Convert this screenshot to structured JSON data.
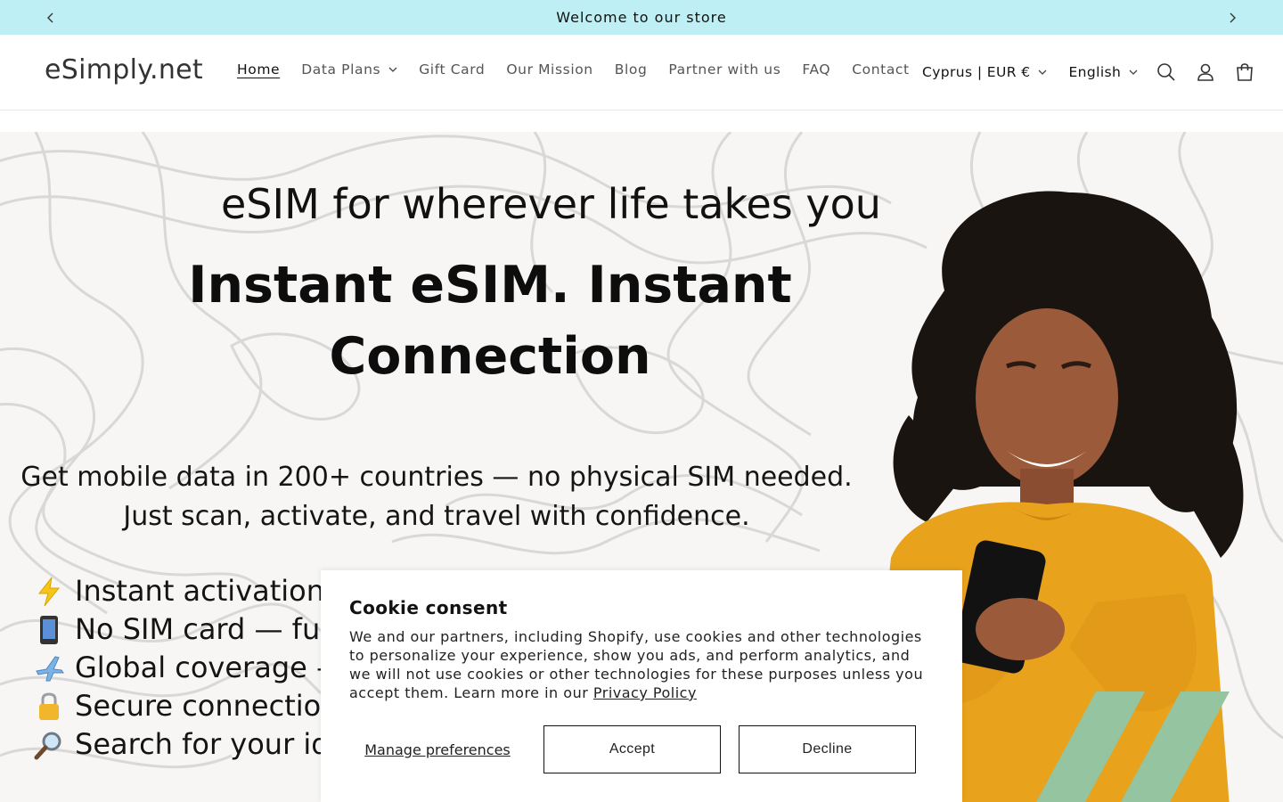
{
  "announcement": {
    "message": "Welcome to our store",
    "prev_icon": "chevron-left-icon",
    "next_icon": "chevron-right-icon"
  },
  "header": {
    "logo": "eSimply.net",
    "nav": [
      {
        "label": "Home"
      },
      {
        "label": "Data Plans"
      },
      {
        "label": "Gift Card"
      },
      {
        "label": "Our Mission"
      },
      {
        "label": "Blog"
      },
      {
        "label": "Partner with us"
      },
      {
        "label": "FAQ"
      },
      {
        "label": "Contact"
      }
    ],
    "country_selector": "Cyprus | EUR €",
    "language_selector": "English",
    "icons": [
      "search-icon",
      "account-icon",
      "cart-icon"
    ]
  },
  "hero": {
    "tagline": "eSIM for wherever life takes you",
    "title_line1": "Instant eSIM. Instant",
    "title_line2": "Connection",
    "subtitle_line1": "Get mobile data in 200+ countries — no physical SIM needed.",
    "subtitle_line2": "Just scan, activate, and travel with confidence.",
    "features": [
      {
        "icon": "lightning-icon",
        "text": "Instant activation –"
      },
      {
        "icon": "phone-icon",
        "text": "No SIM card — fully"
      },
      {
        "icon": "airplane-icon",
        "text": "Global coverage —"
      },
      {
        "icon": "lock-icon",
        "text": "Secure connection"
      },
      {
        "icon": "magnifier-icon",
        "text": "Search for your ide"
      }
    ],
    "colors": {
      "accent_green": "#94c4a0",
      "sweater": "#e8a21c"
    }
  },
  "cookie": {
    "title": "Cookie consent",
    "body": "We and our partners, including Shopify, use cookies and other technologies to personalize your experience, show you ads, and perform analytics, and we will not use cookies or other technologies for these purposes unless you accept them. Learn more in our",
    "privacy_link": "Privacy Policy",
    "manage_label": "Manage preferences",
    "accept_label": "Accept",
    "decline_label": "Decline"
  }
}
